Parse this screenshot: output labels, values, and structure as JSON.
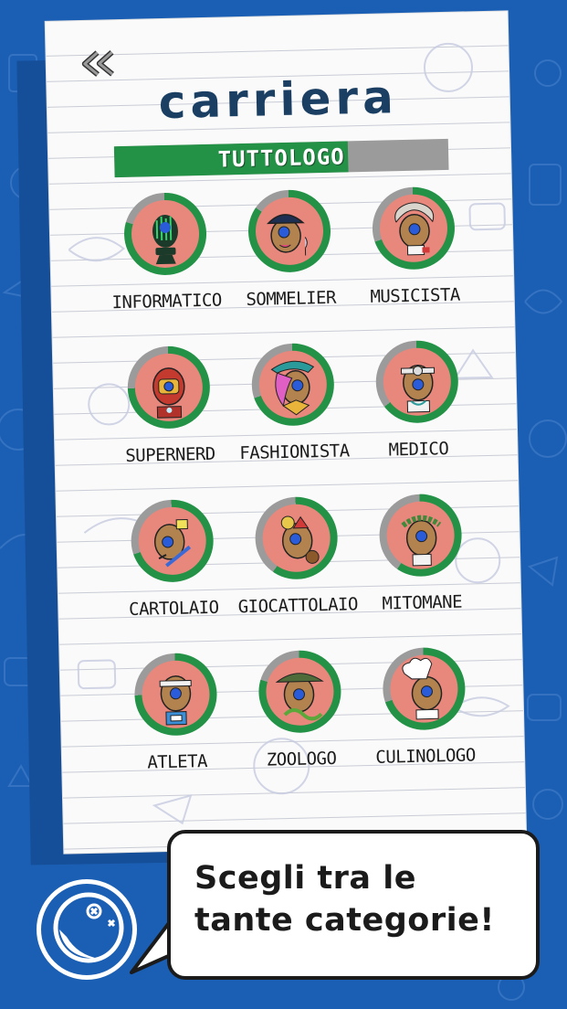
{
  "screen": {
    "title": "carriera",
    "back_icon": "double-chevron-left-icon"
  },
  "progress": {
    "label": "TUTTOLOGO",
    "fraction": 0.7
  },
  "colors": {
    "background": "#1b5fb4",
    "title": "#1b3f62",
    "progress_fill": "#239246",
    "progress_track": "#9b9b9b",
    "badge_ring_green": "#239246",
    "badge_ring_gray": "#9b9b9b",
    "badge_fill": "#e8877c"
  },
  "categories": [
    {
      "label": "INFORMATICO",
      "icon": "programmer-avatar-icon",
      "progress": 0.8
    },
    {
      "label": "SOMMELIER",
      "icon": "sommelier-avatar-icon",
      "progress": 0.85
    },
    {
      "label": "MUSICISTA",
      "icon": "composer-avatar-icon",
      "progress": 0.7
    },
    {
      "label": "SUPERNERD",
      "icon": "superhero-avatar-icon",
      "progress": 0.75
    },
    {
      "label": "FASHIONISTA",
      "icon": "fashion-avatar-icon",
      "progress": 0.7
    },
    {
      "label": "MEDICO",
      "icon": "doctor-avatar-icon",
      "progress": 0.65
    },
    {
      "label": "CARTOLAIO",
      "icon": "stationer-avatar-icon",
      "progress": 0.7
    },
    {
      "label": "GIOCATTOLAIO",
      "icon": "toymaker-avatar-icon",
      "progress": 0.6
    },
    {
      "label": "MITOMANE",
      "icon": "laurel-emperor-avatar-icon",
      "progress": 0.6
    },
    {
      "label": "ATLETA",
      "icon": "athlete-avatar-icon",
      "progress": 0.75
    },
    {
      "label": "ZOOLOGO",
      "icon": "zoologist-avatar-icon",
      "progress": 0.8
    },
    {
      "label": "CULINOLOGO",
      "icon": "chef-avatar-icon",
      "progress": 0.7
    }
  ],
  "promo": {
    "text": "Scegli tra le tante categorie!",
    "logo_icon": "app-mascot-logo-icon"
  }
}
